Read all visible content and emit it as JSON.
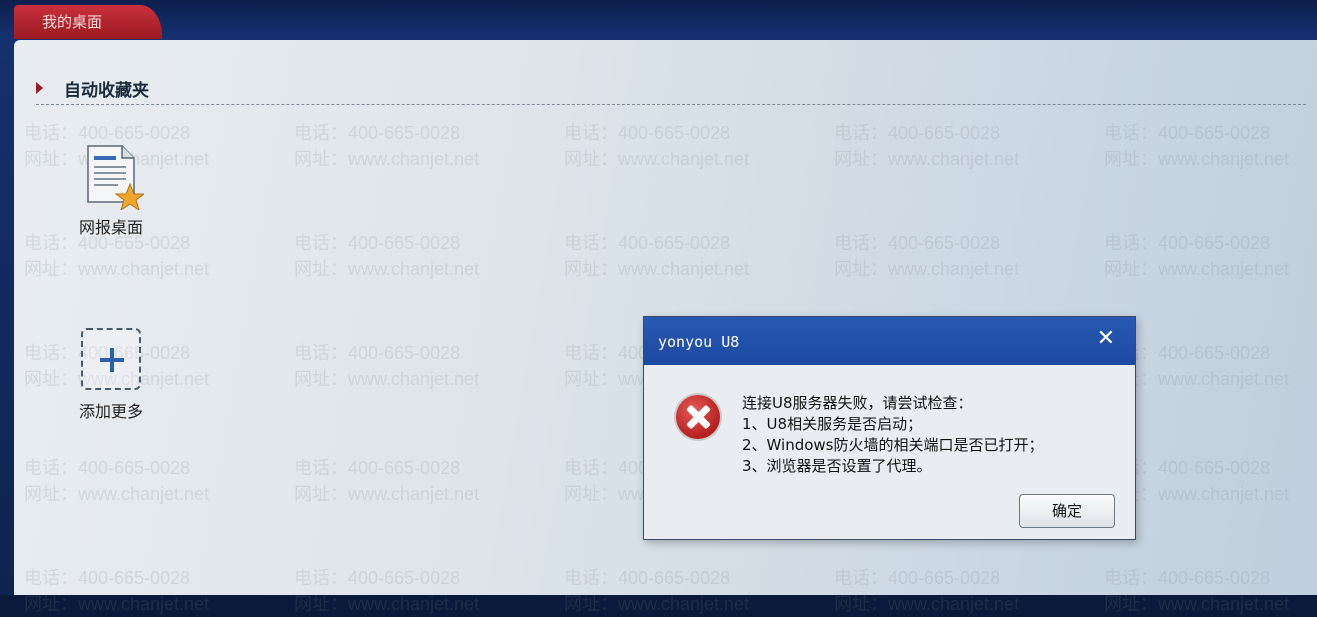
{
  "tab": {
    "label": "我的桌面"
  },
  "section": {
    "title": "自动收藏夹"
  },
  "shortcuts": [
    {
      "label": "网报桌面"
    },
    {
      "label": "添加更多"
    }
  ],
  "watermark": {
    "phone": "电话：400-665-0028",
    "site": "网址：www.chanjet.net"
  },
  "dialog": {
    "title": "yonyou U8",
    "lines": [
      "连接U8服务器失败，请尝试检查：",
      "1、U8相关服务是否启动；",
      "2、Windows防火墙的相关端口是否已打开；",
      "3、浏览器是否设置了代理。"
    ],
    "ok_label": "确定"
  },
  "colors": {
    "tab": "#9c1a22",
    "titlebar": "#1d49a0",
    "error": "#b5201f"
  }
}
